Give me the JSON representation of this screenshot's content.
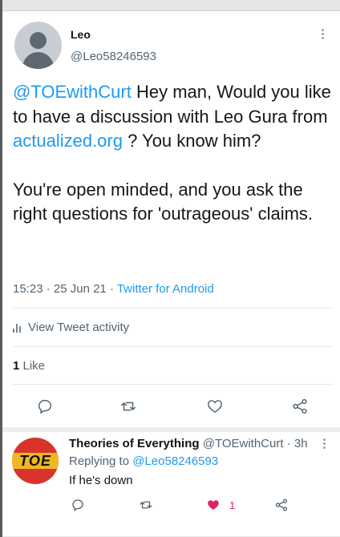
{
  "main_tweet": {
    "display_name": "Leo",
    "handle": "@Leo58246593",
    "text": {
      "mention": "@TOEwithCurt",
      "part1": " Hey man, Would you like to have a discussion with Leo Gura from ",
      "link": "actualized.org",
      "part2": " ? You know him?",
      "paragraph2": "You're open minded, and you ask the right questions for 'outrageous' claims."
    },
    "time": "15:23",
    "date": "25 Jun 21",
    "source": "Twitter for Android",
    "sep": " · ",
    "activity_label": "View Tweet activity",
    "like_count": "1",
    "like_label": " Like"
  },
  "reply": {
    "display_name": "Theories of Everything",
    "handle": "@TOEwithCurt",
    "time": "3h",
    "sep": " · ",
    "avatar_text": "TOE",
    "replying_label": "Replying to ",
    "replying_to": "@Leo58246593",
    "text": "If he's down",
    "like_count": "1"
  },
  "icons": {
    "more": "more-vertical-icon",
    "reply": "reply-icon",
    "retweet": "retweet-icon",
    "like": "heart-icon",
    "share": "share-icon",
    "activity": "bar-chart-icon"
  },
  "colors": {
    "link": "#1d9bf0",
    "secondary_text": "#536471",
    "like_active": "#e0245e",
    "toe_red": "#d8342b",
    "toe_yellow": "#f0b724"
  }
}
